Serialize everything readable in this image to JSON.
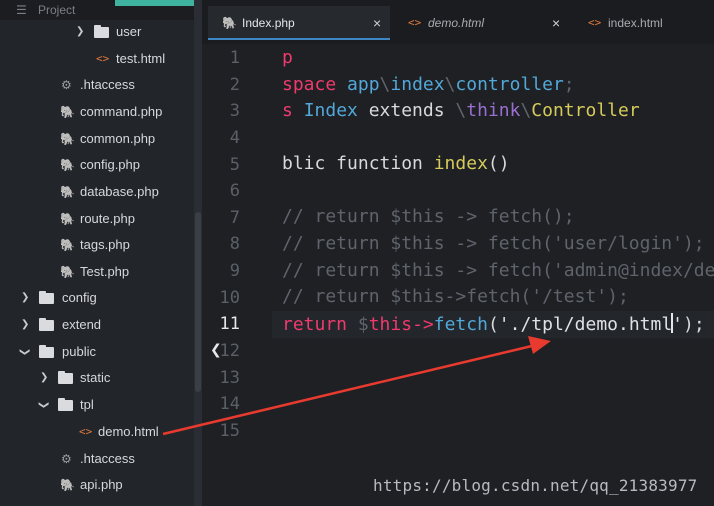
{
  "sidebar": {
    "title": "Project",
    "items": [
      {
        "label": "user",
        "type": "folder",
        "state": "collapsed"
      },
      {
        "label": "test.html",
        "type": "html"
      },
      {
        "label": ".htaccess",
        "type": "settings"
      },
      {
        "label": "command.php",
        "type": "php"
      },
      {
        "label": "common.php",
        "type": "php"
      },
      {
        "label": "config.php",
        "type": "php"
      },
      {
        "label": "database.php",
        "type": "php"
      },
      {
        "label": "route.php",
        "type": "php"
      },
      {
        "label": "tags.php",
        "type": "php"
      },
      {
        "label": "Test.php",
        "type": "php"
      },
      {
        "label": "config",
        "type": "folder",
        "state": "collapsed"
      },
      {
        "label": "extend",
        "type": "folder",
        "state": "collapsed"
      },
      {
        "label": "public",
        "type": "folder",
        "state": "expanded"
      },
      {
        "label": "static",
        "type": "folder",
        "state": "collapsed"
      },
      {
        "label": "tpl",
        "type": "folder",
        "state": "expanded"
      },
      {
        "label": "demo.html",
        "type": "html"
      },
      {
        "label": ".htaccess",
        "type": "settings"
      },
      {
        "label": "api.php",
        "type": "php"
      }
    ]
  },
  "tabs": [
    {
      "label": "Index.php",
      "icon": "php-elephant-icon",
      "active": true,
      "close": "×"
    },
    {
      "label": "demo.html",
      "icon": "html-icon",
      "active": false,
      "close": "×"
    },
    {
      "label": "index.html",
      "icon": "html-icon",
      "active": false,
      "close": ""
    }
  ],
  "editor": {
    "line_numbers": [
      "1",
      "2",
      "3",
      "4",
      "5",
      "6",
      "7",
      "8",
      "9",
      "10",
      "11",
      "12",
      "13",
      "14",
      "15"
    ],
    "current_line": "11",
    "lines": {
      "l1": "p",
      "l2_kw": "space ",
      "l2_ns1": "app",
      "l2_sep1": "\\",
      "l2_ns2": "index",
      "l2_sep2": "\\",
      "l2_ns3": "controller",
      "l2_semi": ";",
      "l3_kw": "s ",
      "l3_cls": "Index",
      "l3_ext": " extends ",
      "l3_sep1": "\\",
      "l3_ns": "think",
      "l3_sep2": "\\",
      "l3_parent": "Controller",
      "l5_a": "blic function ",
      "l5_fn": "index",
      "l5_b": "()",
      "l7": "// return $this -> fetch();",
      "l8": "// return $this -> fetch('user/login');",
      "l9": "// return $this -> fetch('admin@index/de",
      "l10": "// return $this->fetch('/test');",
      "l11_ret": "return ",
      "l11_dollar": "$",
      "l11_this": "this",
      "l11_arrow": "->",
      "l11_fetch": "fetch",
      "l11_open": "(",
      "l11_str_a": "'./tpl/demo.html",
      "l11_str_b": "'",
      "l11_close": ");"
    }
  },
  "watermark": "https://blog.csdn.net/qq_21383977",
  "colors": {
    "accent_tab": "#3f86c5",
    "annotation_arrow": "#e83a2e",
    "keyword": "#f03a6e",
    "namespace": "#52a8d8",
    "class_name": "#d6cb5a"
  }
}
